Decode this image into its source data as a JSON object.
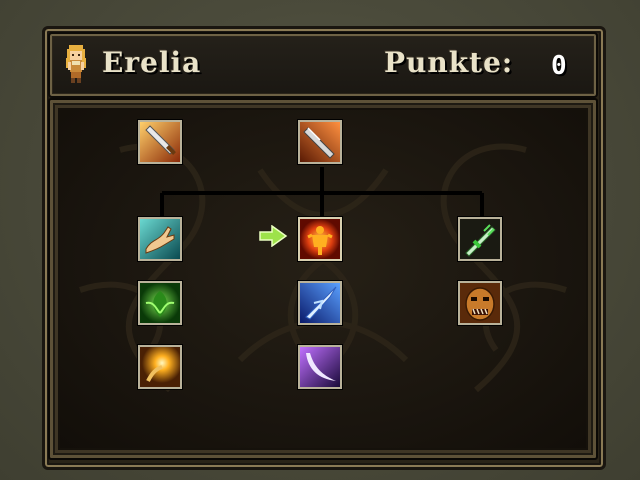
{
  "character": {
    "name": "Erelia",
    "portrait_icon": "hero-portrait-icon"
  },
  "points": {
    "label": "Punkte:",
    "value": "0"
  },
  "skills": [
    {
      "id": "sword-strike-icon",
      "column": 1,
      "row": 1
    },
    {
      "id": "greatsword-icon",
      "column": 2,
      "row": 1
    },
    {
      "id": "healing-hand-icon",
      "column": 1,
      "row": 2
    },
    {
      "id": "fire-aura-icon",
      "column": 2,
      "row": 2,
      "selected": true
    },
    {
      "id": "green-dagger-icon",
      "column": 3,
      "row": 2
    },
    {
      "id": "nature-spirit-icon",
      "column": 1,
      "row": 3
    },
    {
      "id": "ice-lance-icon",
      "column": 2,
      "row": 3
    },
    {
      "id": "demon-mask-icon",
      "column": 3,
      "row": 3
    },
    {
      "id": "holy-light-icon",
      "column": 1,
      "row": 4
    },
    {
      "id": "shadow-slash-icon",
      "column": 2,
      "row": 4
    }
  ],
  "selection_cursor": "green-arrow-icon",
  "colors": {
    "panel_border": "#6e6245",
    "text": "#e9e2c8",
    "cursor": "#9de24a"
  }
}
